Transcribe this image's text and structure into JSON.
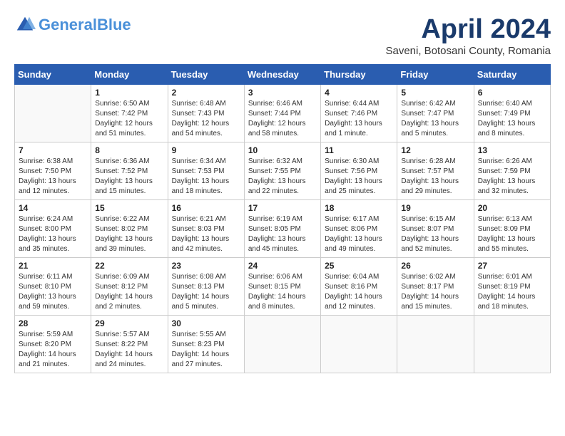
{
  "header": {
    "logo_line1": "General",
    "logo_line2": "Blue",
    "month": "April 2024",
    "location": "Saveni, Botosani County, Romania"
  },
  "weekdays": [
    "Sunday",
    "Monday",
    "Tuesday",
    "Wednesday",
    "Thursday",
    "Friday",
    "Saturday"
  ],
  "weeks": [
    [
      {
        "day": "",
        "info": ""
      },
      {
        "day": "1",
        "info": "Sunrise: 6:50 AM\nSunset: 7:42 PM\nDaylight: 12 hours\nand 51 minutes."
      },
      {
        "day": "2",
        "info": "Sunrise: 6:48 AM\nSunset: 7:43 PM\nDaylight: 12 hours\nand 54 minutes."
      },
      {
        "day": "3",
        "info": "Sunrise: 6:46 AM\nSunset: 7:44 PM\nDaylight: 12 hours\nand 58 minutes."
      },
      {
        "day": "4",
        "info": "Sunrise: 6:44 AM\nSunset: 7:46 PM\nDaylight: 13 hours\nand 1 minute."
      },
      {
        "day": "5",
        "info": "Sunrise: 6:42 AM\nSunset: 7:47 PM\nDaylight: 13 hours\nand 5 minutes."
      },
      {
        "day": "6",
        "info": "Sunrise: 6:40 AM\nSunset: 7:49 PM\nDaylight: 13 hours\nand 8 minutes."
      }
    ],
    [
      {
        "day": "7",
        "info": "Sunrise: 6:38 AM\nSunset: 7:50 PM\nDaylight: 13 hours\nand 12 minutes."
      },
      {
        "day": "8",
        "info": "Sunrise: 6:36 AM\nSunset: 7:52 PM\nDaylight: 13 hours\nand 15 minutes."
      },
      {
        "day": "9",
        "info": "Sunrise: 6:34 AM\nSunset: 7:53 PM\nDaylight: 13 hours\nand 18 minutes."
      },
      {
        "day": "10",
        "info": "Sunrise: 6:32 AM\nSunset: 7:55 PM\nDaylight: 13 hours\nand 22 minutes."
      },
      {
        "day": "11",
        "info": "Sunrise: 6:30 AM\nSunset: 7:56 PM\nDaylight: 13 hours\nand 25 minutes."
      },
      {
        "day": "12",
        "info": "Sunrise: 6:28 AM\nSunset: 7:57 PM\nDaylight: 13 hours\nand 29 minutes."
      },
      {
        "day": "13",
        "info": "Sunrise: 6:26 AM\nSunset: 7:59 PM\nDaylight: 13 hours\nand 32 minutes."
      }
    ],
    [
      {
        "day": "14",
        "info": "Sunrise: 6:24 AM\nSunset: 8:00 PM\nDaylight: 13 hours\nand 35 minutes."
      },
      {
        "day": "15",
        "info": "Sunrise: 6:22 AM\nSunset: 8:02 PM\nDaylight: 13 hours\nand 39 minutes."
      },
      {
        "day": "16",
        "info": "Sunrise: 6:21 AM\nSunset: 8:03 PM\nDaylight: 13 hours\nand 42 minutes."
      },
      {
        "day": "17",
        "info": "Sunrise: 6:19 AM\nSunset: 8:05 PM\nDaylight: 13 hours\nand 45 minutes."
      },
      {
        "day": "18",
        "info": "Sunrise: 6:17 AM\nSunset: 8:06 PM\nDaylight: 13 hours\nand 49 minutes."
      },
      {
        "day": "19",
        "info": "Sunrise: 6:15 AM\nSunset: 8:07 PM\nDaylight: 13 hours\nand 52 minutes."
      },
      {
        "day": "20",
        "info": "Sunrise: 6:13 AM\nSunset: 8:09 PM\nDaylight: 13 hours\nand 55 minutes."
      }
    ],
    [
      {
        "day": "21",
        "info": "Sunrise: 6:11 AM\nSunset: 8:10 PM\nDaylight: 13 hours\nand 59 minutes."
      },
      {
        "day": "22",
        "info": "Sunrise: 6:09 AM\nSunset: 8:12 PM\nDaylight: 14 hours\nand 2 minutes."
      },
      {
        "day": "23",
        "info": "Sunrise: 6:08 AM\nSunset: 8:13 PM\nDaylight: 14 hours\nand 5 minutes."
      },
      {
        "day": "24",
        "info": "Sunrise: 6:06 AM\nSunset: 8:15 PM\nDaylight: 14 hours\nand 8 minutes."
      },
      {
        "day": "25",
        "info": "Sunrise: 6:04 AM\nSunset: 8:16 PM\nDaylight: 14 hours\nand 12 minutes."
      },
      {
        "day": "26",
        "info": "Sunrise: 6:02 AM\nSunset: 8:17 PM\nDaylight: 14 hours\nand 15 minutes."
      },
      {
        "day": "27",
        "info": "Sunrise: 6:01 AM\nSunset: 8:19 PM\nDaylight: 14 hours\nand 18 minutes."
      }
    ],
    [
      {
        "day": "28",
        "info": "Sunrise: 5:59 AM\nSunset: 8:20 PM\nDaylight: 14 hours\nand 21 minutes."
      },
      {
        "day": "29",
        "info": "Sunrise: 5:57 AM\nSunset: 8:22 PM\nDaylight: 14 hours\nand 24 minutes."
      },
      {
        "day": "30",
        "info": "Sunrise: 5:55 AM\nSunset: 8:23 PM\nDaylight: 14 hours\nand 27 minutes."
      },
      {
        "day": "",
        "info": ""
      },
      {
        "day": "",
        "info": ""
      },
      {
        "day": "",
        "info": ""
      },
      {
        "day": "",
        "info": ""
      }
    ]
  ]
}
